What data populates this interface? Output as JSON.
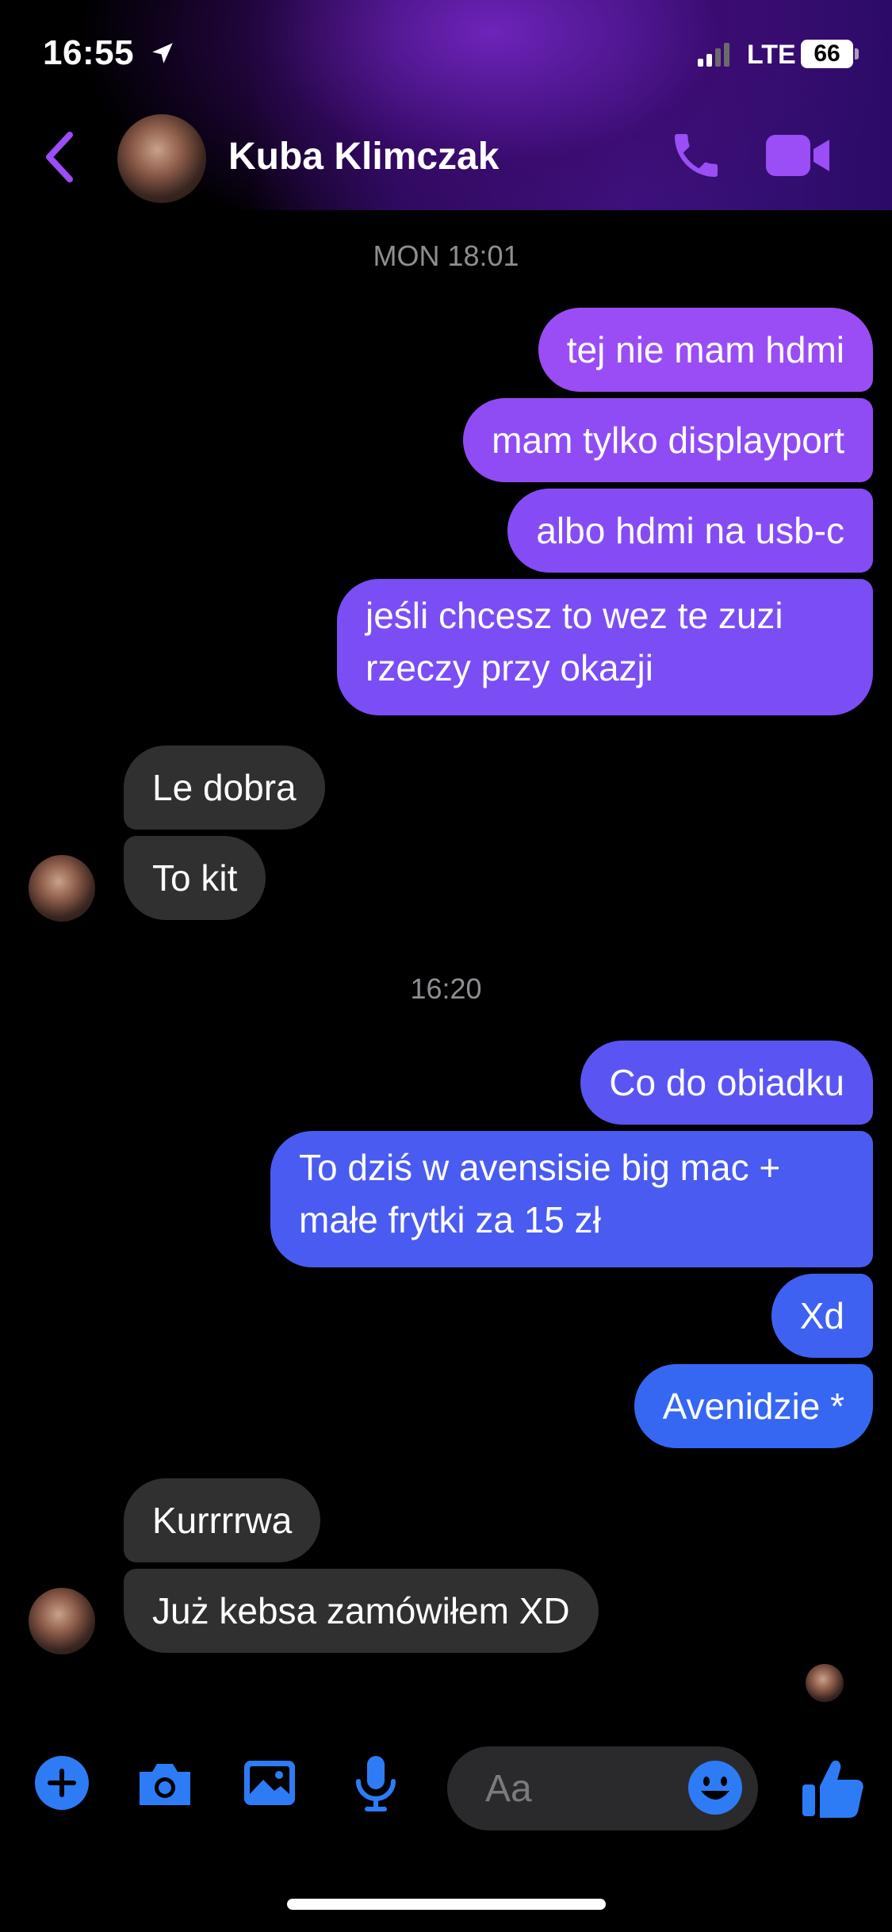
{
  "status_bar": {
    "time": "16:55",
    "network": "LTE",
    "battery": "66"
  },
  "header": {
    "contact_name": "Kuba Klimczak"
  },
  "timestamps": [
    "MON 18:01",
    "16:20"
  ],
  "messages": [
    {
      "dir": "out",
      "text": "tej nie mam hdmi",
      "color": "#9a4df5"
    },
    {
      "dir": "out",
      "text": "mam tylko displayport",
      "color": "#8f4cf5"
    },
    {
      "dir": "out",
      "text": "albo hdmi na usb-c",
      "color": "#854cf5"
    },
    {
      "dir": "out",
      "text": "jeśli chcesz to wez te zuzi rzeczy przy okazji",
      "color": "#7b4df4"
    },
    {
      "dir": "in",
      "text": "Le dobra"
    },
    {
      "dir": "in",
      "text": "To kit"
    },
    {
      "dir": "out",
      "text": "Co do obiadku",
      "color": "#5a55f2"
    },
    {
      "dir": "out",
      "text": "To dziś w avensisie big mac + małe frytki za 15 zł",
      "color": "#4a5bf2"
    },
    {
      "dir": "out",
      "text": "Xd",
      "color": "#3f61f2"
    },
    {
      "dir": "out",
      "text": "Avenidzie *",
      "color": "#3567f2"
    },
    {
      "dir": "in",
      "text": "Kurrrrwa"
    },
    {
      "dir": "in",
      "text": "Już kebsa zamówiłem XD"
    }
  ],
  "composer": {
    "placeholder": "Aa"
  },
  "colors": {
    "accent": "#9b4df6",
    "toolbar_blue": "#2e7bf6",
    "incoming_bubble": "#303030"
  },
  "icons": [
    "location-arrow-icon",
    "signal-icon",
    "back-chevron-icon",
    "phone-icon",
    "video-camera-icon",
    "plus-icon",
    "camera-icon",
    "image-icon",
    "microphone-icon",
    "emoji-icon",
    "thumbs-up-icon"
  ]
}
